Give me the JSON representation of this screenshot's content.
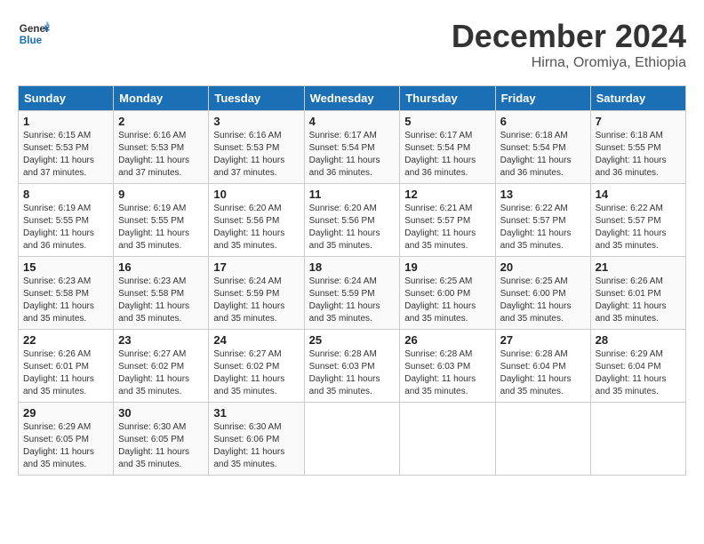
{
  "header": {
    "logo_line1": "General",
    "logo_line2": "Blue",
    "month": "December 2024",
    "location": "Hirna, Oromiya, Ethiopia"
  },
  "weekdays": [
    "Sunday",
    "Monday",
    "Tuesday",
    "Wednesday",
    "Thursday",
    "Friday",
    "Saturday"
  ],
  "weeks": [
    [
      {
        "day": "1",
        "info": "Sunrise: 6:15 AM\nSunset: 5:53 PM\nDaylight: 11 hours and 37 minutes."
      },
      {
        "day": "2",
        "info": "Sunrise: 6:16 AM\nSunset: 5:53 PM\nDaylight: 11 hours and 37 minutes."
      },
      {
        "day": "3",
        "info": "Sunrise: 6:16 AM\nSunset: 5:53 PM\nDaylight: 11 hours and 37 minutes."
      },
      {
        "day": "4",
        "info": "Sunrise: 6:17 AM\nSunset: 5:54 PM\nDaylight: 11 hours and 36 minutes."
      },
      {
        "day": "5",
        "info": "Sunrise: 6:17 AM\nSunset: 5:54 PM\nDaylight: 11 hours and 36 minutes."
      },
      {
        "day": "6",
        "info": "Sunrise: 6:18 AM\nSunset: 5:54 PM\nDaylight: 11 hours and 36 minutes."
      },
      {
        "day": "7",
        "info": "Sunrise: 6:18 AM\nSunset: 5:55 PM\nDaylight: 11 hours and 36 minutes."
      }
    ],
    [
      {
        "day": "8",
        "info": "Sunrise: 6:19 AM\nSunset: 5:55 PM\nDaylight: 11 hours and 36 minutes."
      },
      {
        "day": "9",
        "info": "Sunrise: 6:19 AM\nSunset: 5:55 PM\nDaylight: 11 hours and 35 minutes."
      },
      {
        "day": "10",
        "info": "Sunrise: 6:20 AM\nSunset: 5:56 PM\nDaylight: 11 hours and 35 minutes."
      },
      {
        "day": "11",
        "info": "Sunrise: 6:20 AM\nSunset: 5:56 PM\nDaylight: 11 hours and 35 minutes."
      },
      {
        "day": "12",
        "info": "Sunrise: 6:21 AM\nSunset: 5:57 PM\nDaylight: 11 hours and 35 minutes."
      },
      {
        "day": "13",
        "info": "Sunrise: 6:22 AM\nSunset: 5:57 PM\nDaylight: 11 hours and 35 minutes."
      },
      {
        "day": "14",
        "info": "Sunrise: 6:22 AM\nSunset: 5:57 PM\nDaylight: 11 hours and 35 minutes."
      }
    ],
    [
      {
        "day": "15",
        "info": "Sunrise: 6:23 AM\nSunset: 5:58 PM\nDaylight: 11 hours and 35 minutes."
      },
      {
        "day": "16",
        "info": "Sunrise: 6:23 AM\nSunset: 5:58 PM\nDaylight: 11 hours and 35 minutes."
      },
      {
        "day": "17",
        "info": "Sunrise: 6:24 AM\nSunset: 5:59 PM\nDaylight: 11 hours and 35 minutes."
      },
      {
        "day": "18",
        "info": "Sunrise: 6:24 AM\nSunset: 5:59 PM\nDaylight: 11 hours and 35 minutes."
      },
      {
        "day": "19",
        "info": "Sunrise: 6:25 AM\nSunset: 6:00 PM\nDaylight: 11 hours and 35 minutes."
      },
      {
        "day": "20",
        "info": "Sunrise: 6:25 AM\nSunset: 6:00 PM\nDaylight: 11 hours and 35 minutes."
      },
      {
        "day": "21",
        "info": "Sunrise: 6:26 AM\nSunset: 6:01 PM\nDaylight: 11 hours and 35 minutes."
      }
    ],
    [
      {
        "day": "22",
        "info": "Sunrise: 6:26 AM\nSunset: 6:01 PM\nDaylight: 11 hours and 35 minutes."
      },
      {
        "day": "23",
        "info": "Sunrise: 6:27 AM\nSunset: 6:02 PM\nDaylight: 11 hours and 35 minutes."
      },
      {
        "day": "24",
        "info": "Sunrise: 6:27 AM\nSunset: 6:02 PM\nDaylight: 11 hours and 35 minutes."
      },
      {
        "day": "25",
        "info": "Sunrise: 6:28 AM\nSunset: 6:03 PM\nDaylight: 11 hours and 35 minutes."
      },
      {
        "day": "26",
        "info": "Sunrise: 6:28 AM\nSunset: 6:03 PM\nDaylight: 11 hours and 35 minutes."
      },
      {
        "day": "27",
        "info": "Sunrise: 6:28 AM\nSunset: 6:04 PM\nDaylight: 11 hours and 35 minutes."
      },
      {
        "day": "28",
        "info": "Sunrise: 6:29 AM\nSunset: 6:04 PM\nDaylight: 11 hours and 35 minutes."
      }
    ],
    [
      {
        "day": "29",
        "info": "Sunrise: 6:29 AM\nSunset: 6:05 PM\nDaylight: 11 hours and 35 minutes."
      },
      {
        "day": "30",
        "info": "Sunrise: 6:30 AM\nSunset: 6:05 PM\nDaylight: 11 hours and 35 minutes."
      },
      {
        "day": "31",
        "info": "Sunrise: 6:30 AM\nSunset: 6:06 PM\nDaylight: 11 hours and 35 minutes."
      },
      null,
      null,
      null,
      null
    ]
  ]
}
